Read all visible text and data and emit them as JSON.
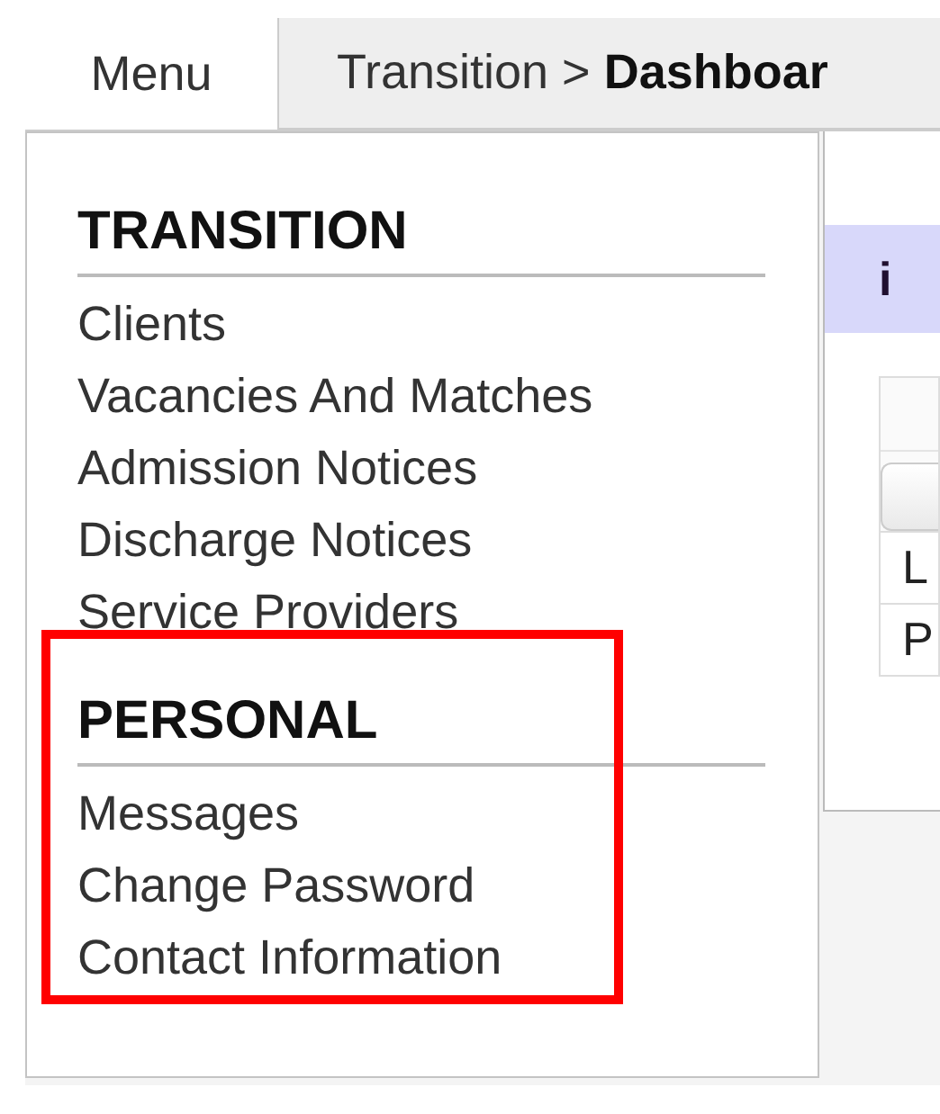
{
  "tabs": [
    {
      "label": "Menu",
      "selected": true
    }
  ],
  "breadcrumb": "Transition > **Dashboar**",
  "menu": {
    "sections": [
      {
        "title": "TRANSITION",
        "highlighted": false,
        "items": [
          "Clients",
          "Vacancies And Matches",
          "Admission Notices",
          "Discharge Notices",
          "Service Providers"
        ]
      },
      {
        "title": "PERSONAL",
        "highlighted": true,
        "items": [
          "Messages",
          "Change Password",
          "Contact Information"
        ]
      }
    ]
  },
  "content": {
    "info_banner": "i",
    "table": {
      "rows": [
        "L",
        "P"
      ]
    }
  }
}
